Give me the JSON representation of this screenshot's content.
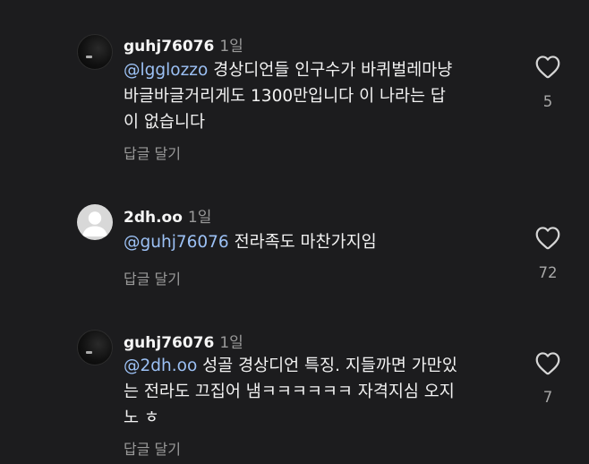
{
  "comments": [
    {
      "username": "guhj76076",
      "time": "1일",
      "mention": "@lgglozzo",
      "text": " 경상디언들 인구수가 바퀴벌레마냥\n바글바글거리게도 1300만입니다 이 나라는 답\n이 없습니다",
      "reply_label": "답글 달기",
      "likes": "5",
      "avatar": "dark-photo"
    },
    {
      "username": "2dh.oo",
      "time": "1일",
      "mention": "@guhj76076",
      "text": " 전라족도 마찬가지임",
      "reply_label": "답글 달기",
      "likes": "72",
      "avatar": "default-person-icon"
    },
    {
      "username": "guhj76076",
      "time": "1일",
      "mention": "@2dh.oo",
      "text": " 성골 경상디언 특징. 지들까면 가만있\n는 전라도 끄집어 냄ㅋㅋㅋㅋㅋㅋ 자격지심 오지\n노 ㅎ",
      "reply_label": "답글 달기",
      "likes": "7",
      "avatar": "dark-photo"
    }
  ],
  "colors": {
    "background": "#1c1c1e",
    "mention": "#9cc1f5",
    "secondary_text": "#9a9a9a"
  },
  "icons": {
    "like": "heart-outline-icon"
  }
}
